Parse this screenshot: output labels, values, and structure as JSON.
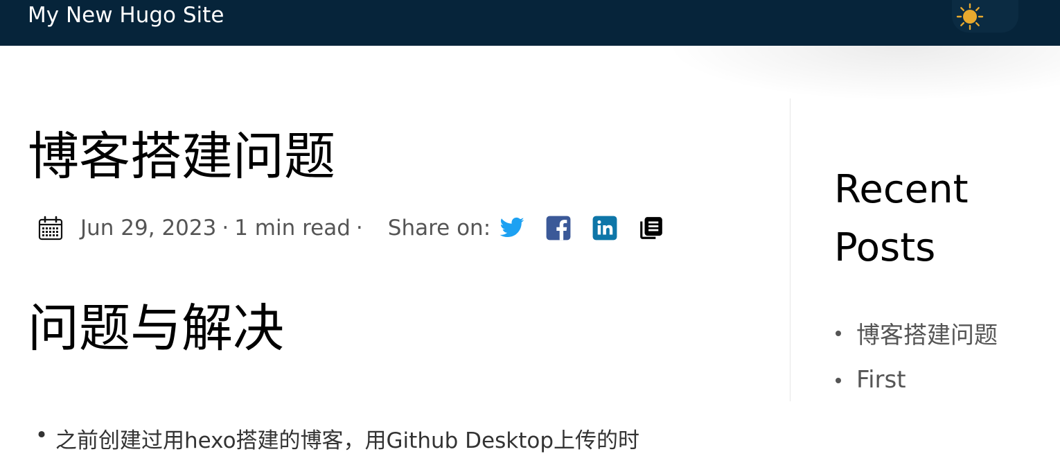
{
  "header": {
    "site_title": "My New Hugo Site",
    "theme_toggle_icon": "sun-icon",
    "background_color": "#06243a",
    "sun_color": "#e8a92e"
  },
  "post": {
    "title": "博客搭建问题",
    "meta": {
      "calendar_icon": "calendar-icon",
      "date": "Jun 29, 2023",
      "separator_1": "·",
      "read_time": "1 min read",
      "separator_2": "·",
      "share_label": "Share on:",
      "share_icons": [
        "twitter-icon",
        "facebook-icon",
        "linkedin-icon",
        "copy-link-icon"
      ]
    },
    "section_heading": "问题与解决",
    "list_items": [
      "之前创建过用hexo搭建的博客，用Github Desktop上传的时"
    ]
  },
  "sidebar": {
    "title": "Recent Posts",
    "items": [
      {
        "label": "博客搭建问题"
      },
      {
        "label": "First"
      }
    ]
  },
  "colors": {
    "twitter": "#1da1f2",
    "facebook": "#3b5998",
    "linkedin": "#0e76a8",
    "text_muted": "#555555"
  }
}
